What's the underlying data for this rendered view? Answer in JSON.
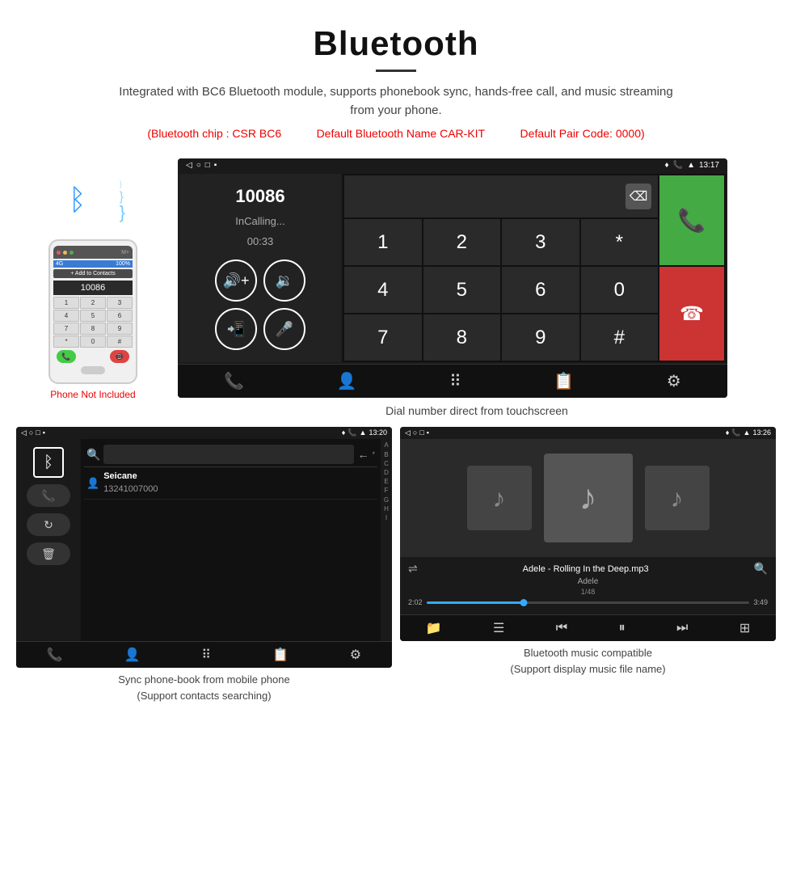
{
  "header": {
    "title": "Bluetooth",
    "description": "Integrated with BC6 Bluetooth module, supports phonebook sync, hands-free call, and music streaming from your phone.",
    "specs": {
      "chip": "(Bluetooth chip : CSR BC6",
      "name": "Default Bluetooth Name CAR-KIT",
      "code": "Default Pair Code: 0000)"
    }
  },
  "phone_section": {
    "not_included": "Phone Not Included"
  },
  "dial_screen": {
    "status_bar": {
      "nav_icons": [
        "◁",
        "○",
        "□",
        "▪"
      ],
      "right_icons": [
        "♦",
        "📞",
        "▲",
        "13:17"
      ]
    },
    "caller_number": "10086",
    "caller_status": "InCalling...",
    "call_timer": "00:33",
    "dialpad_keys": [
      "1",
      "2",
      "3",
      "*",
      "4",
      "5",
      "6",
      "0",
      "7",
      "8",
      "9",
      "#"
    ],
    "caption": "Dial number direct from touchscreen"
  },
  "phonebook_screen": {
    "status_time": "13:20",
    "contact_name": "Seicane",
    "contact_number": "13241007000",
    "alphabet": [
      "A",
      "B",
      "C",
      "D",
      "E",
      "F",
      "G",
      "H",
      "I"
    ],
    "caption_line1": "Sync phone-book from mobile phone",
    "caption_line2": "(Support contacts searching)"
  },
  "music_screen": {
    "status_time": "13:26",
    "song_title": "Adele - Rolling In the Deep.mp3",
    "artist": "Adele",
    "track_num": "1/48",
    "time_current": "2:02",
    "time_total": "3:49",
    "caption_line1": "Bluetooth music compatible",
    "caption_line2": "(Support display music file name)"
  }
}
